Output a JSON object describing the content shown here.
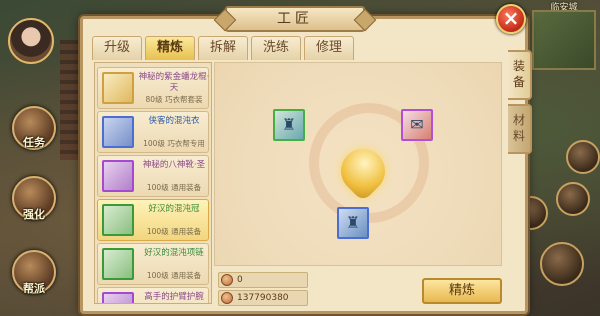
{
  "dialog": {
    "title": "工匠",
    "close_icon": "×"
  },
  "tabs": [
    {
      "label": "升级",
      "active": false
    },
    {
      "label": "精炼",
      "active": true
    },
    {
      "label": "拆解",
      "active": false
    },
    {
      "label": "洗练",
      "active": false
    },
    {
      "label": "修理",
      "active": false
    }
  ],
  "side_tabs": [
    {
      "label": "装备",
      "active": true
    },
    {
      "label": "材料",
      "active": false
    }
  ],
  "items": [
    {
      "name": "神秘的紫金蟠龙棍·天",
      "sub": "80级  巧衣帮套装",
      "quality": "purple",
      "icon": "staff-icon"
    },
    {
      "name": "侠客的混沌衣",
      "sub": "100级  巧衣帮专用",
      "quality": "blue",
      "icon": "armor-icon"
    },
    {
      "name": "神秘的八神靴·圣",
      "sub": "100级  通用装备",
      "quality": "purple",
      "icon": "boots-icon"
    },
    {
      "name": "好汉的混沌冠",
      "sub": "100级  通用装备",
      "quality": "green",
      "icon": "helmet-icon",
      "selected": true
    },
    {
      "name": "好汉的混沌项链",
      "sub": "100级  通用装备",
      "quality": "green",
      "icon": "necklace-icon"
    },
    {
      "name": "高手的护臂护腕",
      "sub": "",
      "quality": "purple",
      "icon": "bracer-icon"
    }
  ],
  "work_area": {
    "main_slot": "helmet-icon",
    "material_slot": "scroll-icon",
    "result_slot": "helmet-icon"
  },
  "currency": {
    "cost": "0",
    "owned": "137790380"
  },
  "refine_button": "精炼",
  "hud": {
    "left_buttons": [
      "任务",
      "强化",
      "帮派"
    ],
    "minimap_title": "临安城",
    "avatar_name": "头像"
  },
  "colors": {
    "panel_bg": "#f3e6c6",
    "panel_border": "#b8955e",
    "active_tab": "#e8c050",
    "close_button": "#c02a18"
  }
}
